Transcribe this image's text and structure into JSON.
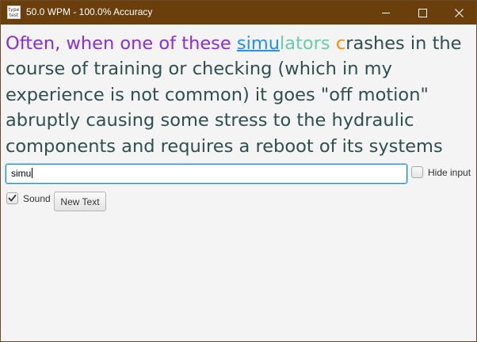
{
  "window": {
    "title": "50.0 WPM - 100.0% Accuracy",
    "icon_text_top": "type",
    "icon_text_bottom": "test",
    "controls": {
      "minimize": "minimize-icon",
      "maximize": "maximize-icon",
      "close": "close-icon"
    }
  },
  "passage": {
    "typed": "Often, when one of these ",
    "current_word_correct": "simu",
    "current_word_remaining": "lators",
    "space": " ",
    "next_char": "c",
    "rest": "rashes in the course of training or checking (which in my experience is not common) it goes \"off motion\" abruptly causing some stress to the hydraulic components and requires a reboot of its systems that utilizes valuable time.",
    "colors": {
      "typed": "#8a2be2",
      "current_correct": "#1e90ff",
      "current_remaining": "#66cdaa",
      "next_char": "#ff8c00",
      "rest": "#2f4f4f"
    }
  },
  "input": {
    "value": "simu"
  },
  "options": {
    "hide_input": {
      "label": "Hide input",
      "checked": false
    },
    "sound": {
      "label": "Sound",
      "checked": true
    }
  },
  "buttons": {
    "new_text": "New Text"
  },
  "accent_color": "#6a3f0c"
}
